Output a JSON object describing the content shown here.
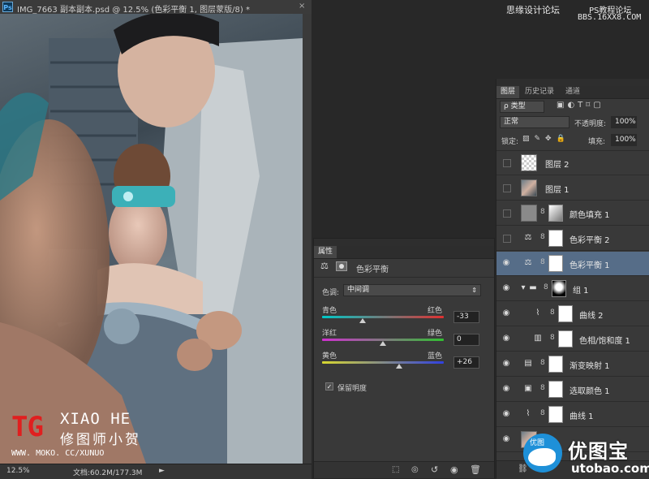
{
  "document": {
    "ps_icon": "Ps",
    "title": "IMG_7663 副本副本.psd @ 12.5% (色彩平衡 1, 图层蒙版/8) *",
    "close": "×",
    "zoom": "12.5%",
    "doc_size": "文档:60.2M/177.3M",
    "nav_arrow": "►"
  },
  "watermarks": {
    "top_right_1": "思缘设计论坛",
    "top_right_2": "PS教程论坛",
    "top_right_3": "BBS.16XX8.COM",
    "tg": "TG",
    "xiao_he": "XIAO HE",
    "xiao_he_cn": "修图师小贺",
    "url": "WWW. MOKO. CC/XUNUO",
    "brand_cn": "优图宝",
    "brand_url": "utobao.com",
    "bird": "优图"
  },
  "properties": {
    "tab": "属性",
    "title": "色彩平衡",
    "tone_label": "色调:",
    "tone_value": "中间调",
    "sliders": [
      {
        "left": "青色",
        "right": "红色",
        "value": "-33",
        "level": 0.335,
        "grad": "linear-gradient(90deg,#00c8c8,#e03030)"
      },
      {
        "left": "洋红",
        "right": "绿色",
        "value": "0",
        "level": 0.5,
        "grad": "linear-gradient(90deg,#d030d0,#30c030)"
      },
      {
        "left": "黄色",
        "right": "蓝色",
        "value": "+26",
        "level": 0.63,
        "grad": "linear-gradient(90deg,#d8d830,#3040e0)"
      }
    ],
    "preserve_luminosity": "保留明度",
    "check": "✓",
    "footer_icons": [
      "clip-icon",
      "view-previous-icon",
      "reset-icon",
      "visibility-icon",
      "delete-icon"
    ]
  },
  "layers_panel": {
    "tabs": [
      "图层",
      "历史记录",
      "通道"
    ],
    "filter": "ρ 类型",
    "blend_mode": "正常",
    "opacity_label": "不透明度:",
    "opacity": "100%",
    "lock_label": "锁定:",
    "fill_label": "填充:",
    "fill": "100%",
    "layers": [
      {
        "name": "图层 2",
        "visible": false,
        "thumb": "checker"
      },
      {
        "name": "图层 1",
        "visible": false,
        "thumb": "photo"
      },
      {
        "name": "颜色填充 1",
        "visible": false,
        "thumb": "gray",
        "mask": true
      },
      {
        "name": "色彩平衡 2",
        "visible": false,
        "icon": "⚖",
        "mask": true
      },
      {
        "name": "色彩平衡 1",
        "visible": true,
        "icon": "⚖",
        "mask": true,
        "selected": true
      },
      {
        "name": "组 1",
        "visible": true,
        "icon": "▾",
        "folder": true,
        "mask": true
      },
      {
        "name": "曲线 2",
        "visible": true,
        "icon": "⌇",
        "mask": true,
        "indent": true
      },
      {
        "name": "色相/饱和度 1",
        "visible": true,
        "icon": "▥",
        "mask": true,
        "indent": true
      },
      {
        "name": "渐变映射 1",
        "visible": true,
        "icon": "▤",
        "mask": true
      },
      {
        "name": "选取颜色 1",
        "visible": true,
        "icon": "▣",
        "mask": true
      },
      {
        "name": "曲线 1",
        "visible": true,
        "icon": "⌇",
        "mask": true
      },
      {
        "name": "",
        "visible": true,
        "thumb": "photo"
      }
    ],
    "eye_glyph": "👁",
    "chain_glyph": "8"
  }
}
